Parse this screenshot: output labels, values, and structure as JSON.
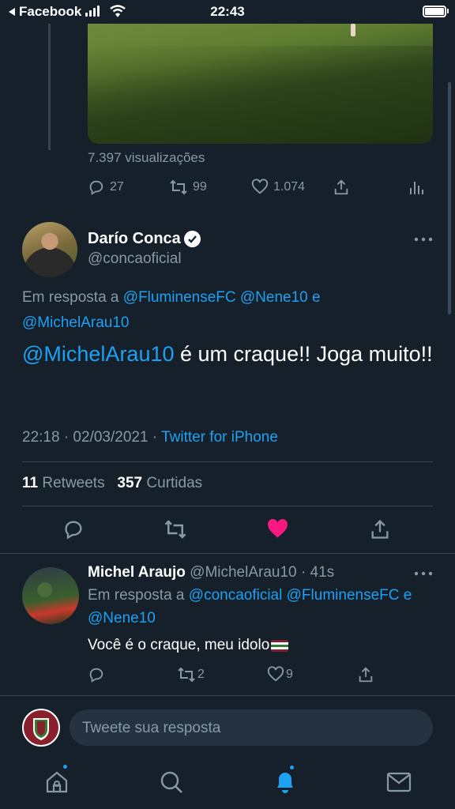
{
  "status_bar": {
    "back_label": "Facebook",
    "time": "22:43"
  },
  "prev_tweet": {
    "views": "7.397 visualizações",
    "replies": "27",
    "retweets": "99",
    "likes": "1.074"
  },
  "main_tweet": {
    "display_name": "Darío Conca",
    "handle": "@concaoficial",
    "reply_prefix": "Em resposta a",
    "reply_to": [
      "@FluminenseFC",
      "@Nene10",
      "@MichelArau10"
    ],
    "reply_and": "e",
    "mention": "@MichelArau10",
    "body": " é um craque!! Joga muito!!",
    "time_date": "22:18 · 02/03/2021 · ",
    "source": "Twitter for iPhone",
    "retweet_count": "11",
    "retweet_label": "Retweets",
    "like_count": "357",
    "like_label": "Curtidas",
    "liked_color": "#f91880"
  },
  "reply": {
    "display_name": "Michel Araujo",
    "handle_time": "@MichelArau10 · 41s",
    "reply_prefix": "Em resposta a",
    "reply_to": [
      "@concaoficial",
      "@FluminenseFC",
      "@Nene10"
    ],
    "reply_and": "e",
    "body": "Você é o craque, meu idolo",
    "retweets": "2",
    "likes": "9"
  },
  "composer": {
    "placeholder": "Tweete sua resposta"
  },
  "tabbar": {
    "items": [
      "home-icon",
      "search-icon",
      "notifications-icon",
      "messages-icon"
    ]
  },
  "colors": {
    "background": "#15202b",
    "accent": "#1da1f2",
    "secondary_text": "#8899a6"
  }
}
